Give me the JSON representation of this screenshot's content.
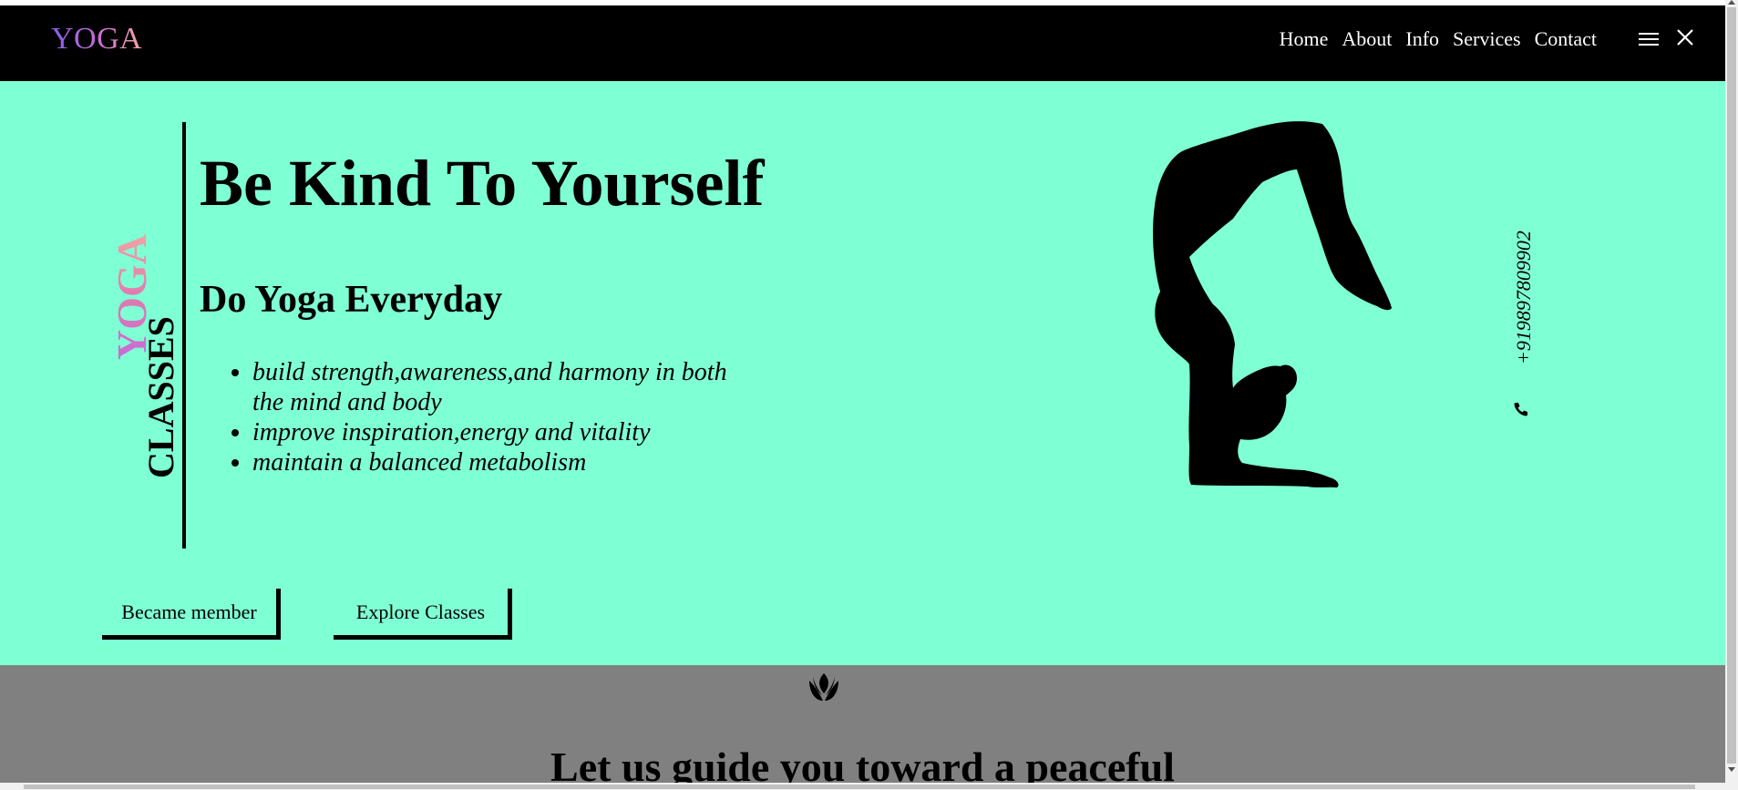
{
  "nav": {
    "logo": "YOGA",
    "links": [
      "Home",
      "About",
      "Info",
      "Services",
      "Contact"
    ],
    "menu_icon": "hamburger-icon",
    "close_icon": "close-icon"
  },
  "hero": {
    "side_title_top": "YOGA",
    "side_title_bottom": "CLASSES",
    "headline": "Be Kind To Yourself",
    "subheading": "Do Yoga Everyday",
    "benefits": [
      "build strength,awareness,and harmony in both the mind and body",
      "improve inspiration,energy and vitality",
      "maintain a balanced metabolism"
    ],
    "buttons": {
      "member": "Became member",
      "explore": "Explore Classes"
    },
    "phone": "+919897809902",
    "phone_icon": "phone-icon",
    "image": "yoga-pose-silhouette"
  },
  "guide_section": {
    "icon": "lotus-icon",
    "heading": "Let us guide you toward a peaceful"
  },
  "colors": {
    "nav_bg": "#000000",
    "hero_bg": "#7fffd4",
    "section_bg": "#808080",
    "logo_gradient": [
      "#7f5fe0",
      "#c86ad9",
      "#f3a3a3"
    ]
  }
}
